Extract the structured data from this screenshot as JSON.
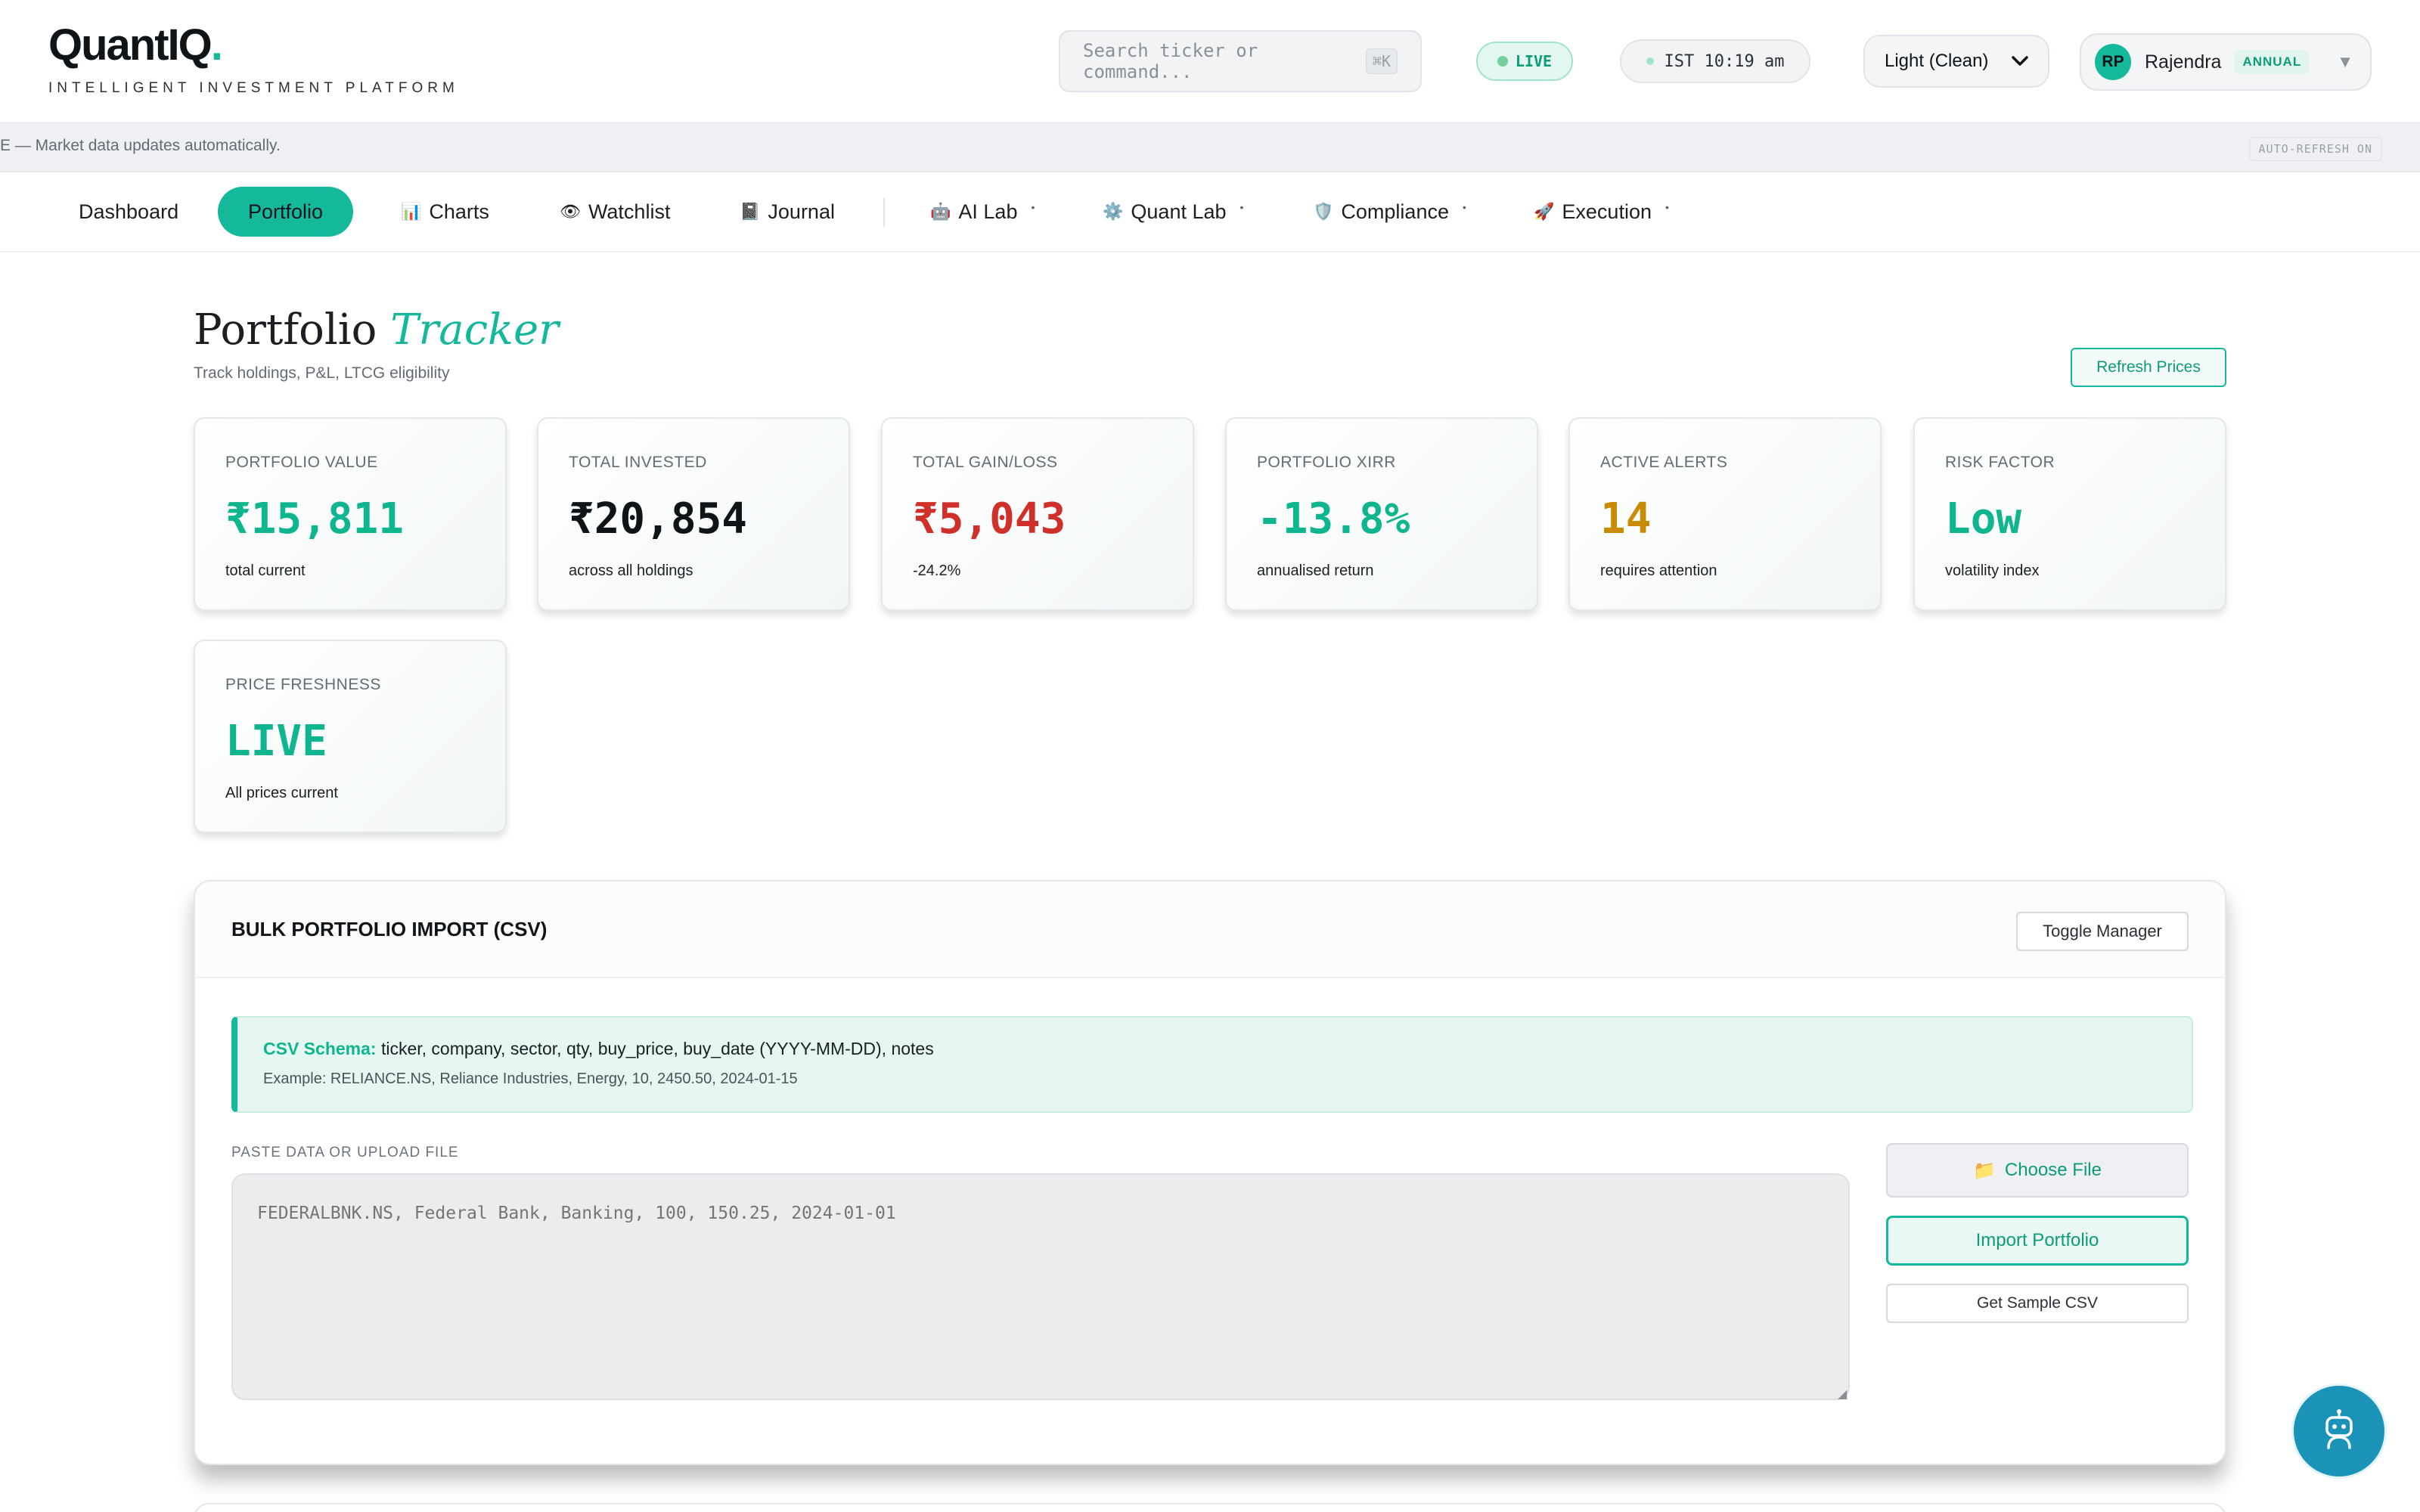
{
  "brand": {
    "name": "QuantIQ",
    "dot": ".",
    "tagline": "INTELLIGENT INVESTMENT PLATFORM"
  },
  "header": {
    "search_placeholder": "Search ticker or command...",
    "search_shortcut": "⌘K",
    "live_label": "LIVE",
    "clock": "IST 10:19 am",
    "theme": "Light (Clean)",
    "user": {
      "initials": "RP",
      "name": "Rajendra",
      "plan": "ANNUAL"
    }
  },
  "ticker": {
    "message": "E — Market data updates automatically.",
    "auto_refresh": "AUTO-REFRESH ON"
  },
  "nav": {
    "items": [
      {
        "label": "Dashboard",
        "icon": "",
        "dropdown": false
      },
      {
        "label": "Portfolio",
        "icon": "",
        "dropdown": false
      },
      {
        "label": "Charts",
        "icon": "📊",
        "dropdown": false
      },
      {
        "label": "Watchlist",
        "icon": "👁",
        "dropdown": false
      },
      {
        "label": "Journal",
        "icon": "📓",
        "dropdown": false
      },
      {
        "label": "AI Lab",
        "icon": "🤖",
        "dropdown": true
      },
      {
        "label": "Quant Lab",
        "icon": "⚙️",
        "dropdown": true
      },
      {
        "label": "Compliance",
        "icon": "🛡️",
        "dropdown": true
      },
      {
        "label": "Execution",
        "icon": "🚀",
        "dropdown": true
      }
    ],
    "active": "Portfolio"
  },
  "page": {
    "title": "Portfolio",
    "title_accent": "Tracker",
    "subtitle": "Track holdings, P&L, LTCG eligibility",
    "refresh_label": "Refresh Prices"
  },
  "metrics": [
    {
      "label": "PORTFOLIO VALUE",
      "value": "₹15,811",
      "sub": "total current",
      "tone": "green"
    },
    {
      "label": "TOTAL INVESTED",
      "value": "₹20,854",
      "sub": "across all holdings",
      "tone": "dark"
    },
    {
      "label": "TOTAL GAIN/LOSS",
      "value": "₹5,043",
      "sub": "-24.2%",
      "tone": "red"
    },
    {
      "label": "PORTFOLIO XIRR",
      "value": "-13.8%",
      "sub": "annualised return",
      "tone": "green"
    },
    {
      "label": "ACTIVE ALERTS",
      "value": "14",
      "sub": "requires attention",
      "tone": "amber"
    },
    {
      "label": "RISK FACTOR",
      "value": "Low",
      "sub": "volatility index",
      "tone": "green"
    },
    {
      "label": "PRICE FRESHNESS",
      "value": "LIVE",
      "sub": "All prices current",
      "tone": "green"
    }
  ],
  "import_panel": {
    "title": "BULK PORTFOLIO IMPORT (CSV)",
    "toggle_label": "Toggle Manager",
    "schema_key": "CSV Schema:",
    "schema_fields": " ticker, company, sector, qty, buy_price, buy_date (YYYY-MM-DD), notes",
    "schema_example": "Example: RELIANCE.NS, Reliance Industries, Energy, 10, 2450.50, 2024-01-15",
    "paste_label": "PASTE DATA OR UPLOAD FILE",
    "textarea_placeholder": "FEDERALBNK.NS, Federal Bank, Banking, 100, 150.25, 2024-01-01",
    "choose_file": "Choose File",
    "import_label": "Import Portfolio",
    "sample_label": "Get Sample CSV"
  }
}
